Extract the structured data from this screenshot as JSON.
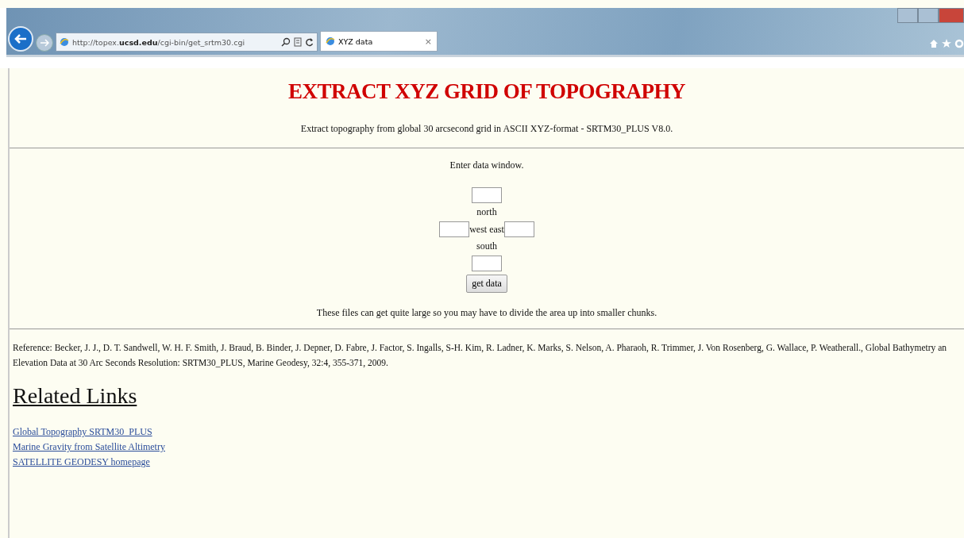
{
  "browser": {
    "address": "http://topex.**ucsd.edu**/cgi-bin/get_srtm30.cgi",
    "tab_title": "XYZ data",
    "tab_close": "×"
  },
  "page": {
    "title": "EXTRACT XYZ GRID OF TOPOGRAPHY",
    "subtitle": "Extract topography from global 30 arcsecond grid in ASCII XYZ-format - SRTM30_PLUS V8.0.",
    "prompt": "Enter data window.",
    "labels": {
      "north": "north",
      "west": "west",
      "east": "east",
      "south": "south"
    },
    "button": "get data",
    "note": "These files can get quite large so you may have to divide the area up into smaller chunks.",
    "reference": "Reference: Becker, J. J., D. T. Sandwell, W. H. F. Smith, J. Braud, B. Binder, J. Depner, D. Fabre, J. Factor, S. Ingalls, S-H. Kim, R. Ladner, K. Marks, S. Nelson, A. Pharaoh, R. Trimmer, J. Von Rosenberg, G. Wallace, P. Weatherall., Global Bathymetry an\nElevation Data at 30 Arc Seconds Resolution: SRTM30_PLUS, Marine Geodesy, 32:4, 355-371, 2009.",
    "links_heading": "Related Links",
    "links": [
      "Global Topography SRTM30_PLUS",
      "Marine Gravity from Satellite Altimetry",
      "SATELLITE GEODESY homepage"
    ]
  }
}
